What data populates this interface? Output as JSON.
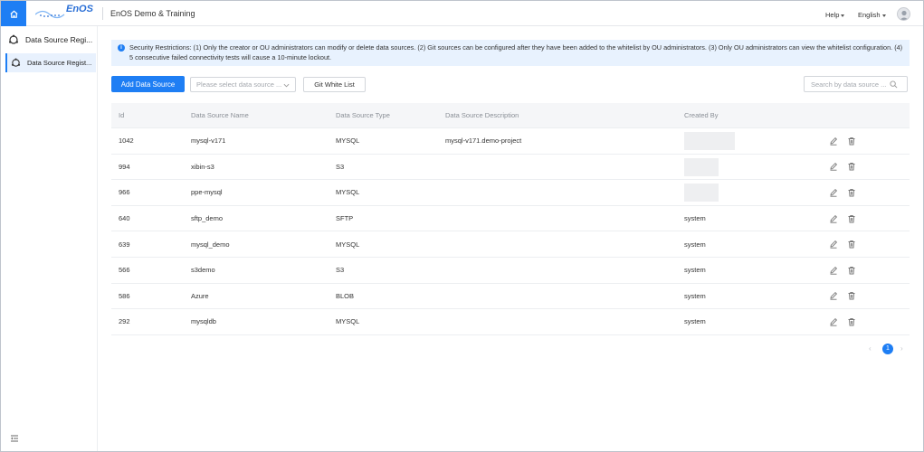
{
  "header": {
    "logo_text": "EnOS",
    "app_title": "EnOS Demo & Training",
    "help_label": "Help",
    "language_label": "English"
  },
  "sidebar": {
    "section_title": "Data Source Regi...",
    "items": [
      {
        "label": "Data Source Regist..."
      }
    ]
  },
  "notice": {
    "text": "Security Restrictions: (1) Only the creator or OU administrators can modify or delete data sources. (2) Git sources can be configured after they have been added to the whitelist by OU administrators. (3) Only OU administrators can view the whitelist configuration. (4) 5 consecutive failed connectivity tests will cause a 10-minute lockout."
  },
  "toolbar": {
    "add_label": "Add Data Source",
    "select_placeholder": "Please select data source ...",
    "whitelist_label": "Git White List",
    "search_placeholder": "Search by data source ..."
  },
  "table": {
    "columns": [
      "Id",
      "Data Source Name",
      "Data Source Type",
      "Data Source Description",
      "Created By"
    ],
    "rows": [
      {
        "id": "1042",
        "name": "mysql-v171",
        "type": "MYSQL",
        "desc": "mysql-v171.demo-project",
        "by": ""
      },
      {
        "id": "994",
        "name": "xibin-s3",
        "type": "S3",
        "desc": "",
        "by": ""
      },
      {
        "id": "966",
        "name": "ppe-mysql",
        "type": "MYSQL",
        "desc": "",
        "by": ""
      },
      {
        "id": "640",
        "name": "sftp_demo",
        "type": "SFTP",
        "desc": "",
        "by": "system"
      },
      {
        "id": "639",
        "name": "mysql_demo",
        "type": "MYSQL",
        "desc": "",
        "by": "system"
      },
      {
        "id": "566",
        "name": "s3demo",
        "type": "S3",
        "desc": "",
        "by": "system"
      },
      {
        "id": "586",
        "name": "Azure",
        "type": "BLOB",
        "desc": "",
        "by": "system"
      },
      {
        "id": "292",
        "name": "mysqldb",
        "type": "MYSQL",
        "desc": "",
        "by": "system"
      }
    ]
  },
  "pagination": {
    "current_page": "1"
  },
  "colors": {
    "accent": "#1e7ef4",
    "notice_bg": "#e8f2fe",
    "header_bg": "#f5f6f8"
  }
}
